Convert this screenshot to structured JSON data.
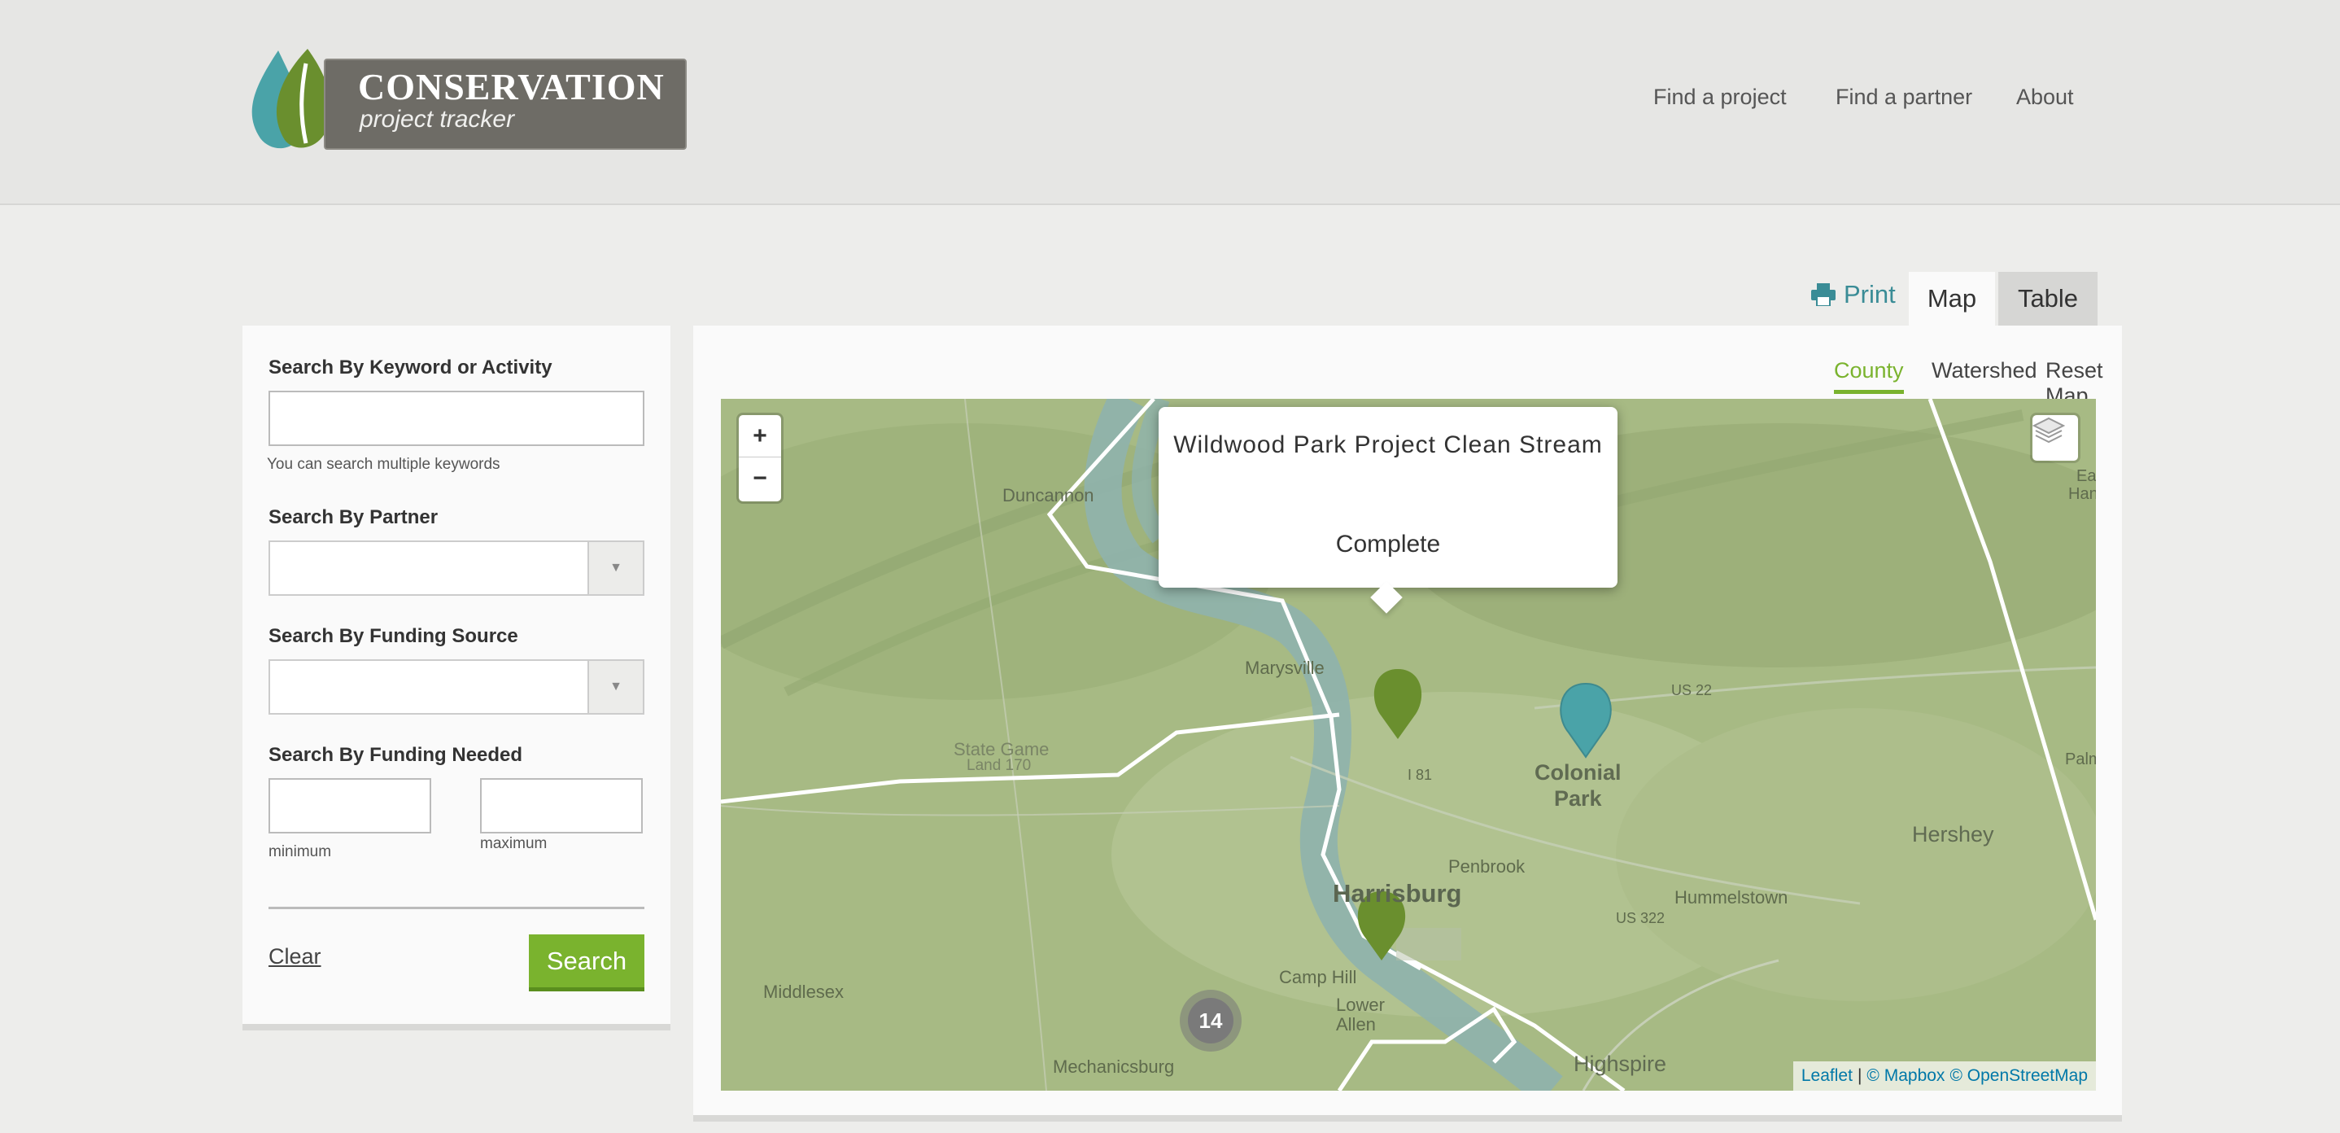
{
  "header": {
    "logo_title": "CONSERVATION",
    "logo_subtitle": "project tracker",
    "nav": [
      {
        "label": "Find a project"
      },
      {
        "label": "Find a partner"
      },
      {
        "label": "About"
      }
    ]
  },
  "view": {
    "print_label": "Print",
    "tabs": [
      {
        "label": "Map",
        "active": true
      },
      {
        "label": "Table",
        "active": false
      }
    ]
  },
  "sidebar": {
    "keyword": {
      "label": "Search By Keyword or Activity",
      "value": "",
      "help": "You can search multiple keywords"
    },
    "partner": {
      "label": "Search By Partner",
      "value": ""
    },
    "funding_source": {
      "label": "Search By Funding Source",
      "value": ""
    },
    "funding_needed": {
      "label": "Search By Funding Needed",
      "min_help": "minimum",
      "max_help": "maximum"
    },
    "clear_label": "Clear",
    "search_label": "Search"
  },
  "map": {
    "layer_tabs": [
      {
        "label": "County",
        "active": true
      },
      {
        "label": "Watershed",
        "active": false
      },
      {
        "label": "Reset Map",
        "active": false
      }
    ],
    "zoom_in": "+",
    "zoom_out": "−",
    "popup": {
      "title": "Wildwood Park Project Clean Stream",
      "status": "Complete"
    },
    "cluster_count": "14",
    "places": {
      "duncannon": "Duncannon",
      "marysville": "Marysville",
      "state_game_1": "State Game",
      "state_game_2": "Land 170",
      "colonial_1": "Colonial",
      "colonial_2": "Park",
      "harrisburg": "Harrisburg",
      "penbrook": "Penbrook",
      "hummelstown": "Hummelstown",
      "hershey": "Hershey",
      "camp_hill": "Camp Hill",
      "lower_1": "Lower",
      "lower_2": "Allen",
      "middlesex": "Middlesex",
      "mechanicsburg": "Mechanicsburg",
      "highspire": "Highspire",
      "i81": "I 81",
      "us22": "US 22",
      "us322": "US 322",
      "east_1": "Ea",
      "east_2": "Han",
      "palm": "Palm"
    },
    "attribution": {
      "leaflet": "Leaflet",
      "sep": "|",
      "mapbox": "© Mapbox",
      "osm": "© OpenStreetMap"
    },
    "marker_colors": {
      "green": "#6a8f2e",
      "teal": "#4aa3a8"
    }
  }
}
